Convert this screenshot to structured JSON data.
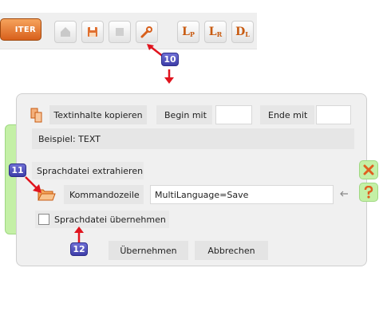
{
  "toolbar": {
    "filter_label": "ITER",
    "lang_buttons": [
      {
        "main": "L",
        "sub": "P"
      },
      {
        "main": "L",
        "sub": "R"
      },
      {
        "main": "D",
        "sub": "L"
      }
    ]
  },
  "callouts": [
    "10",
    "11",
    "12"
  ],
  "dialog": {
    "copy_text": "Textinhalte kopieren",
    "begin_label": "Begin mit",
    "begin_value": "",
    "end_label": "Ende mit",
    "end_value": "",
    "example": "Beispiel: TEXT",
    "extract_label": "Sprachdatei extrahieren",
    "command_label": "Kommandozeile",
    "command_value": "MultiLanguage=Save",
    "adopt_label": "Sprachdatei übernehmen",
    "apply_button": "Übernehmen",
    "cancel_button": "Abbrechen"
  },
  "colors": {
    "accent": "#d8601c",
    "badge": "#4646b4",
    "arrow": "#e0141e",
    "side_green": "#c4f0a6"
  }
}
